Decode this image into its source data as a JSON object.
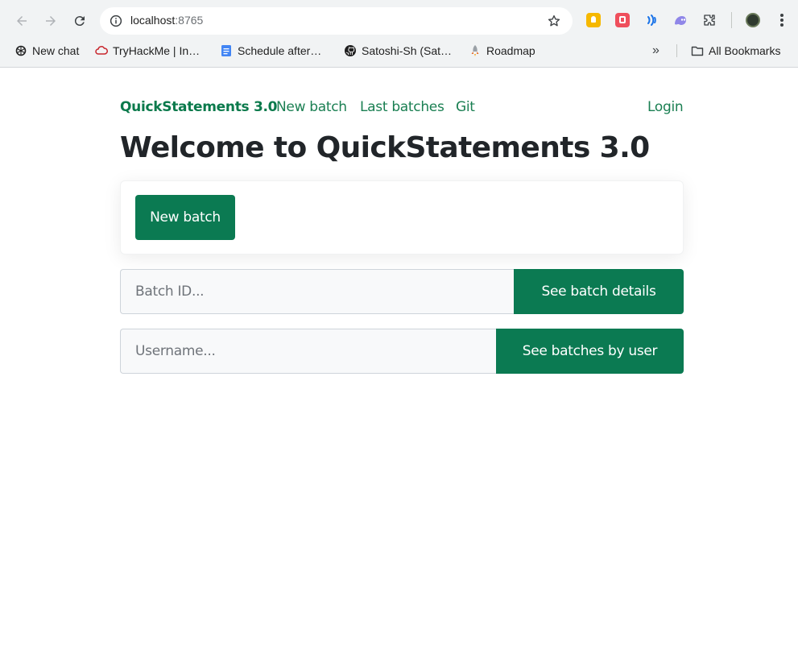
{
  "browser": {
    "url_host": "localhost",
    "url_port": ":8765",
    "bookmarks": [
      {
        "label": "New chat",
        "icon": "openai-icon"
      },
      {
        "label": "TryHackMe | In…",
        "icon": "tryhackme-icon"
      },
      {
        "label": "Schedule after…",
        "icon": "google-docs-icon"
      },
      {
        "label": "Satoshi-Sh (Sat…",
        "icon": "github-icon"
      },
      {
        "label": "Roadmap",
        "icon": "rocket-icon"
      }
    ],
    "more_bookmarks": "»",
    "all_bookmarks": "All Bookmarks"
  },
  "navbar": {
    "brand": "QuickStatements 3.0",
    "links": [
      "New batch",
      "Last batches",
      "Git"
    ],
    "login": "Login"
  },
  "main": {
    "title": "Welcome to QuickStatements 3.0",
    "new_batch_button": "New batch",
    "batch_id": {
      "placeholder": "Batch ID...",
      "button": "See batch details"
    },
    "username": {
      "placeholder": "Username...",
      "button": "See batches by user"
    }
  },
  "colors": {
    "accent": "#0b7a52",
    "link": "#1a7f52",
    "text": "#212529"
  }
}
